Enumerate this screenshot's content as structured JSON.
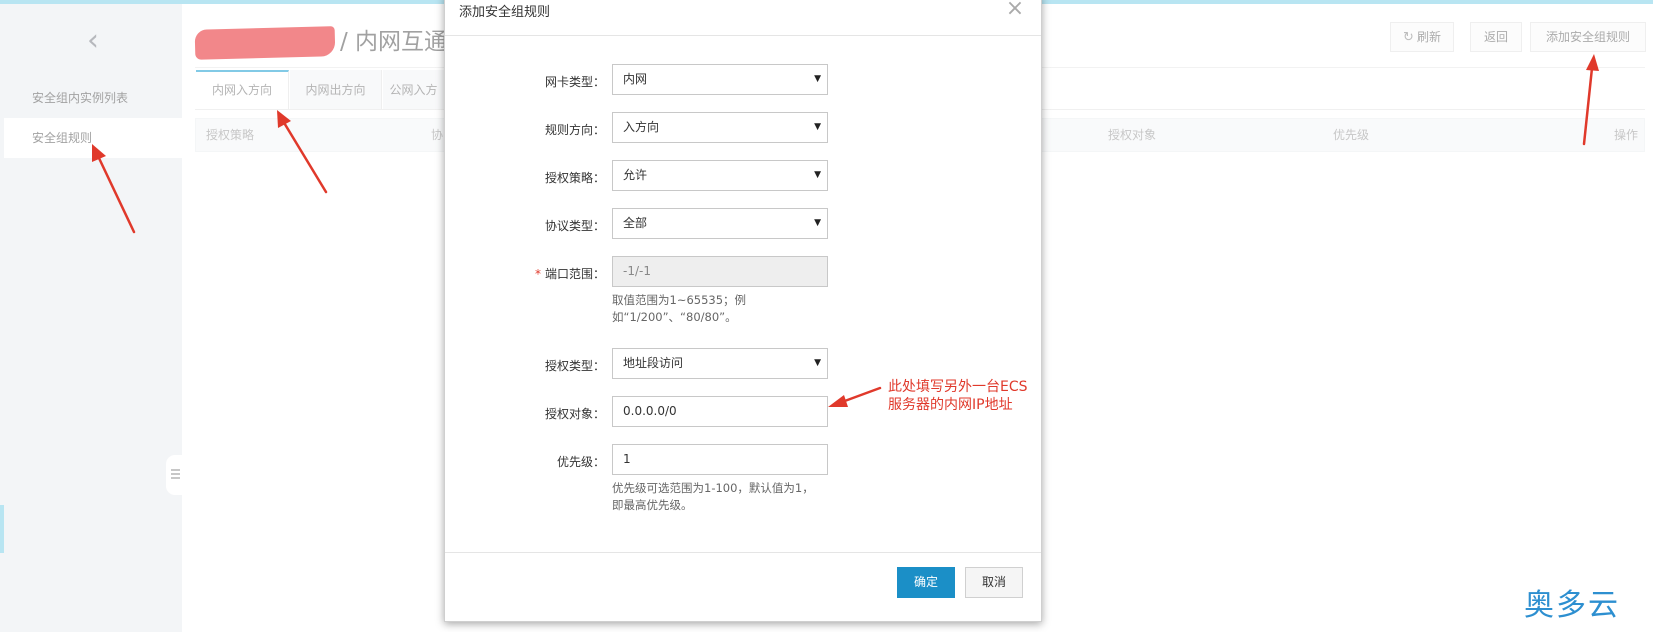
{
  "sidebar": {
    "items": [
      {
        "label": "安全组内实例列表"
      },
      {
        "label": "安全组规则"
      }
    ]
  },
  "header": {
    "title": "/ 内网互通",
    "buttons": {
      "refresh": "刷新",
      "back": "返回",
      "add_rule": "添加安全组规则"
    }
  },
  "tabs": [
    {
      "label": "内网入方向"
    },
    {
      "label": "内网出方向"
    },
    {
      "label": "公网入方"
    }
  ],
  "table": {
    "columns": [
      "授权策略",
      "协",
      "授权对象",
      "优先级",
      "操作"
    ]
  },
  "dialog": {
    "title": "添加安全组规则",
    "fields": {
      "nic_type": {
        "label": "网卡类型：",
        "value": "内网"
      },
      "direction": {
        "label": "规则方向：",
        "value": "入方向"
      },
      "policy": {
        "label": "授权策略：",
        "value": "允许"
      },
      "protocol": {
        "label": "协议类型：",
        "value": "全部"
      },
      "port_range": {
        "label": "端口范围：",
        "required_mark": "*",
        "value": "-1/-1",
        "help_line1": "取值范围为1~65535；例",
        "help_line2": "如“1/200”、“80/80”。"
      },
      "auth_type": {
        "label": "授权类型：",
        "value": "地址段访问"
      },
      "auth_object": {
        "label": "授权对象：",
        "value": "0.0.0.0/0"
      },
      "priority": {
        "label": "优先级：",
        "value": "1",
        "help_line1": "优先级可选范围为1-100，默认值为1，",
        "help_line2": "即最高优先级。"
      }
    },
    "buttons": {
      "ok": "确定",
      "cancel": "取消"
    }
  },
  "annotation": {
    "line1": "此处填写另外一台ECS",
    "line2": "服务器的内网IP地址",
    "color": "#e0392b"
  },
  "watermark": "奥多云",
  "colors": {
    "accent": "#1b8fc7",
    "tab_active": "#1d9fd1",
    "sidebar_bg": "#eaedf1"
  }
}
